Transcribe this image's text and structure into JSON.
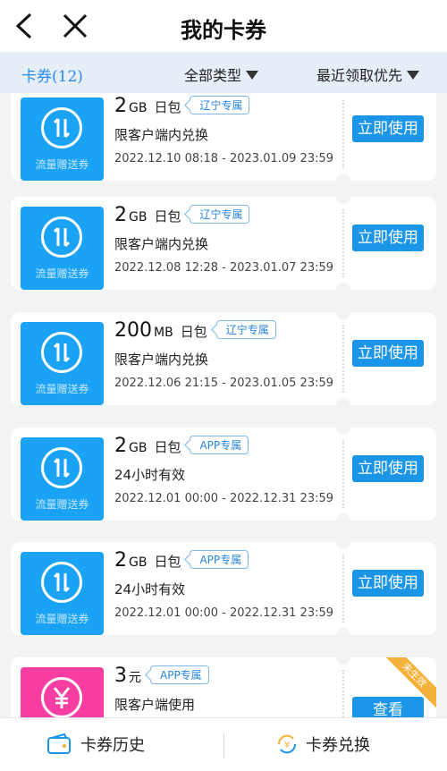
{
  "header": {
    "title": "我的卡券",
    "back_icon": "back-arrow-icon",
    "close_icon": "close-icon"
  },
  "filter": {
    "tab_label": "卡券(12)",
    "type_label": "全部类型",
    "sort_label": "最近领取优先"
  },
  "coupons": [
    {
      "icon": "data-transfer-icon",
      "caption": "流量赠送券",
      "amount": "2",
      "unit": "GB",
      "kind": "日包",
      "tag": "辽宁专属",
      "desc": "限客户端内兑换",
      "validity": "2022.12.10 08:18 - 2023.01.09 23:59",
      "button": "立即使用"
    },
    {
      "icon": "data-transfer-icon",
      "caption": "流量赠送券",
      "amount": "2",
      "unit": "GB",
      "kind": "日包",
      "tag": "辽宁专属",
      "desc": "限客户端内兑换",
      "validity": "2022.12.08 12:28 - 2023.01.07 23:59",
      "button": "立即使用"
    },
    {
      "icon": "data-transfer-icon",
      "caption": "流量赠送券",
      "amount": "200",
      "unit": "MB",
      "kind": "日包",
      "tag": "辽宁专属",
      "desc": "限客户端内兑换",
      "validity": "2022.12.06 21:15 - 2023.01.05 23:59",
      "button": "立即使用"
    },
    {
      "icon": "data-transfer-icon",
      "caption": "流量赠送券",
      "amount": "2",
      "unit": "GB",
      "kind": "日包",
      "tag": "APP专属",
      "desc": "24小时有效",
      "validity": "2022.12.01 00:00 - 2022.12.31 23:59",
      "button": "立即使用"
    },
    {
      "icon": "data-transfer-icon",
      "caption": "流量赠送券",
      "amount": "2",
      "unit": "GB",
      "kind": "日包",
      "tag": "APP专属",
      "desc": "24小时有效",
      "validity": "2022.12.01 00:00 - 2022.12.31 23:59",
      "button": "立即使用"
    },
    {
      "icon": "yuan-icon",
      "amount": "3",
      "unit": "元",
      "tag": "APP专属",
      "desc": "限客户端使用",
      "button": "查看",
      "ribbon": "未生效"
    }
  ],
  "bottom": {
    "history_label": "卡券历史",
    "exchange_label": "卡券兑换",
    "history_icon": "wallet-icon",
    "exchange_icon": "exchange-icon"
  },
  "colors": {
    "accent_blue": "#1b95e8",
    "tab_blue": "#2b8ce8",
    "coupon_blue": "#1aa3f4",
    "coupon_pink": "#f93ea3",
    "ribbon_orange": "#f4b23a"
  }
}
